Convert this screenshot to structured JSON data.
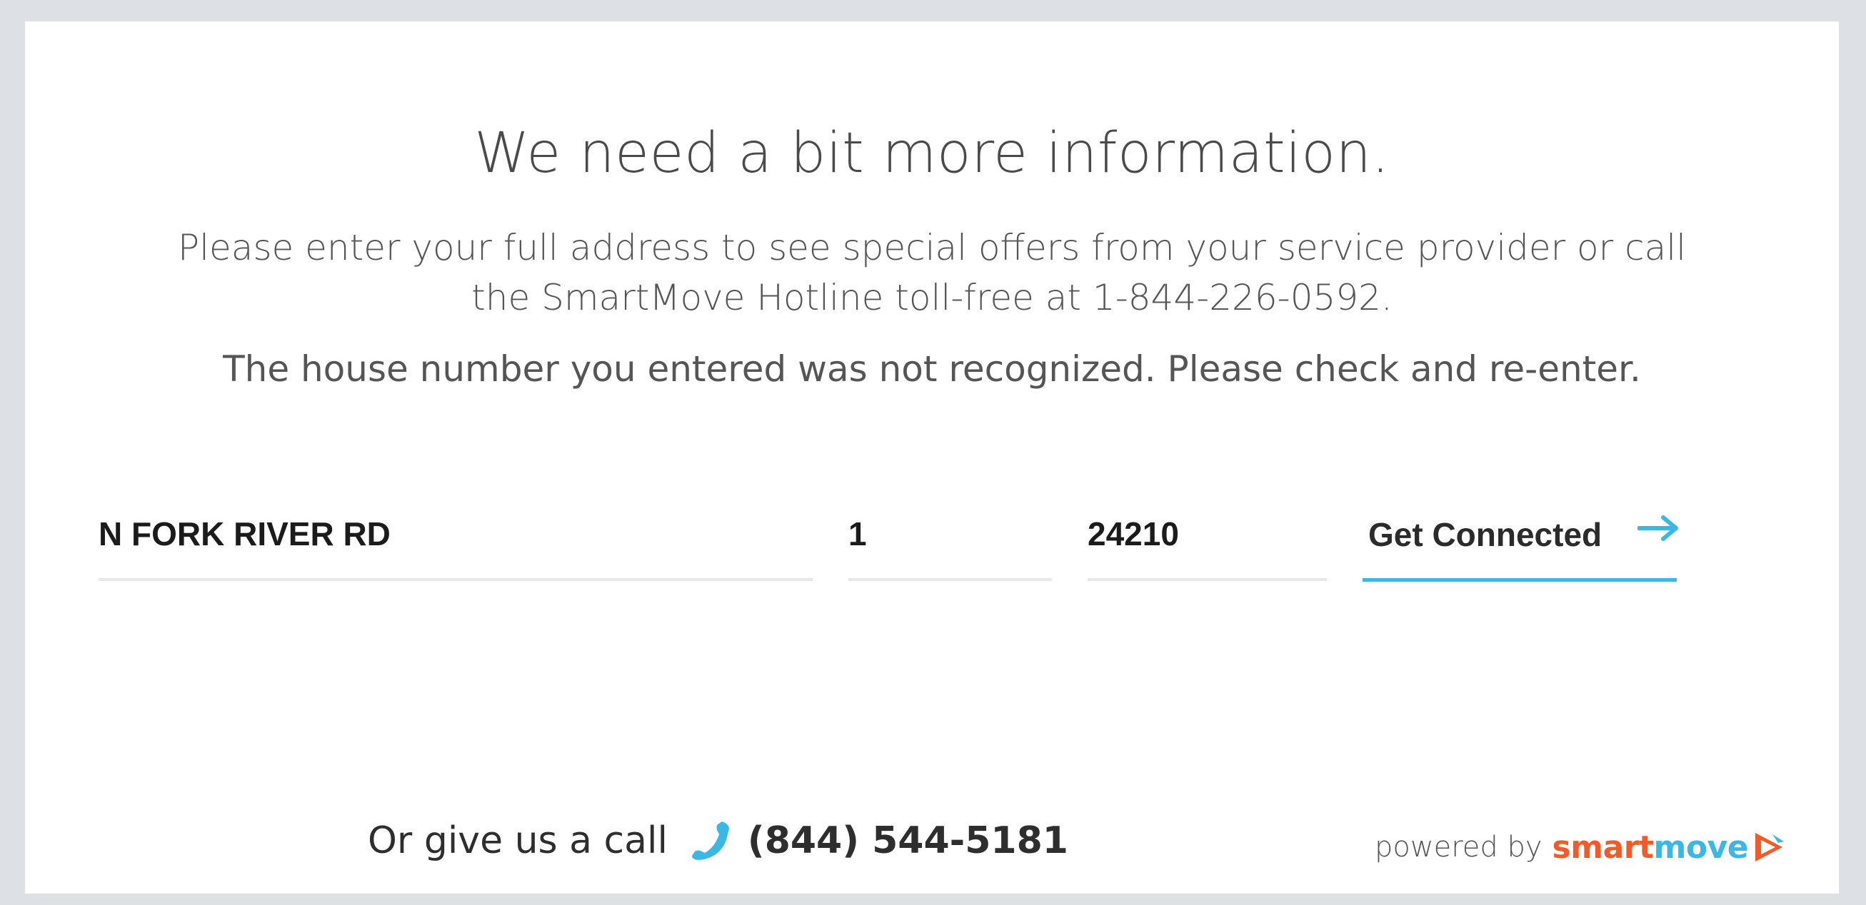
{
  "heading": "We need a bit more information.",
  "subtext_line1": "Please enter your full address to see special offers from your service provider or call",
  "subtext_line2": "the SmartMove Hotline toll-free at 1-844-226-0592.",
  "error_message": "The house number you entered was not recognized. Please check and re-enter.",
  "form": {
    "street_value": "N FORK RIVER RD",
    "house_number_value": "1",
    "zip_value": "24210",
    "submit_label": "Get Connected"
  },
  "footer": {
    "call_prompt": "Or give us a call",
    "phone_number": "(844) 544-5181",
    "powered_by": "powered by",
    "brand_part1": "smart",
    "brand_part2": "move"
  },
  "colors": {
    "accent_blue": "#3bb7e3",
    "brand_orange": "#f15a29",
    "field_underline": "#e3e6ea"
  },
  "icons": {
    "submit": "arrow-right-icon",
    "call": "phone-icon",
    "brand": "smartmove-play-icon"
  }
}
